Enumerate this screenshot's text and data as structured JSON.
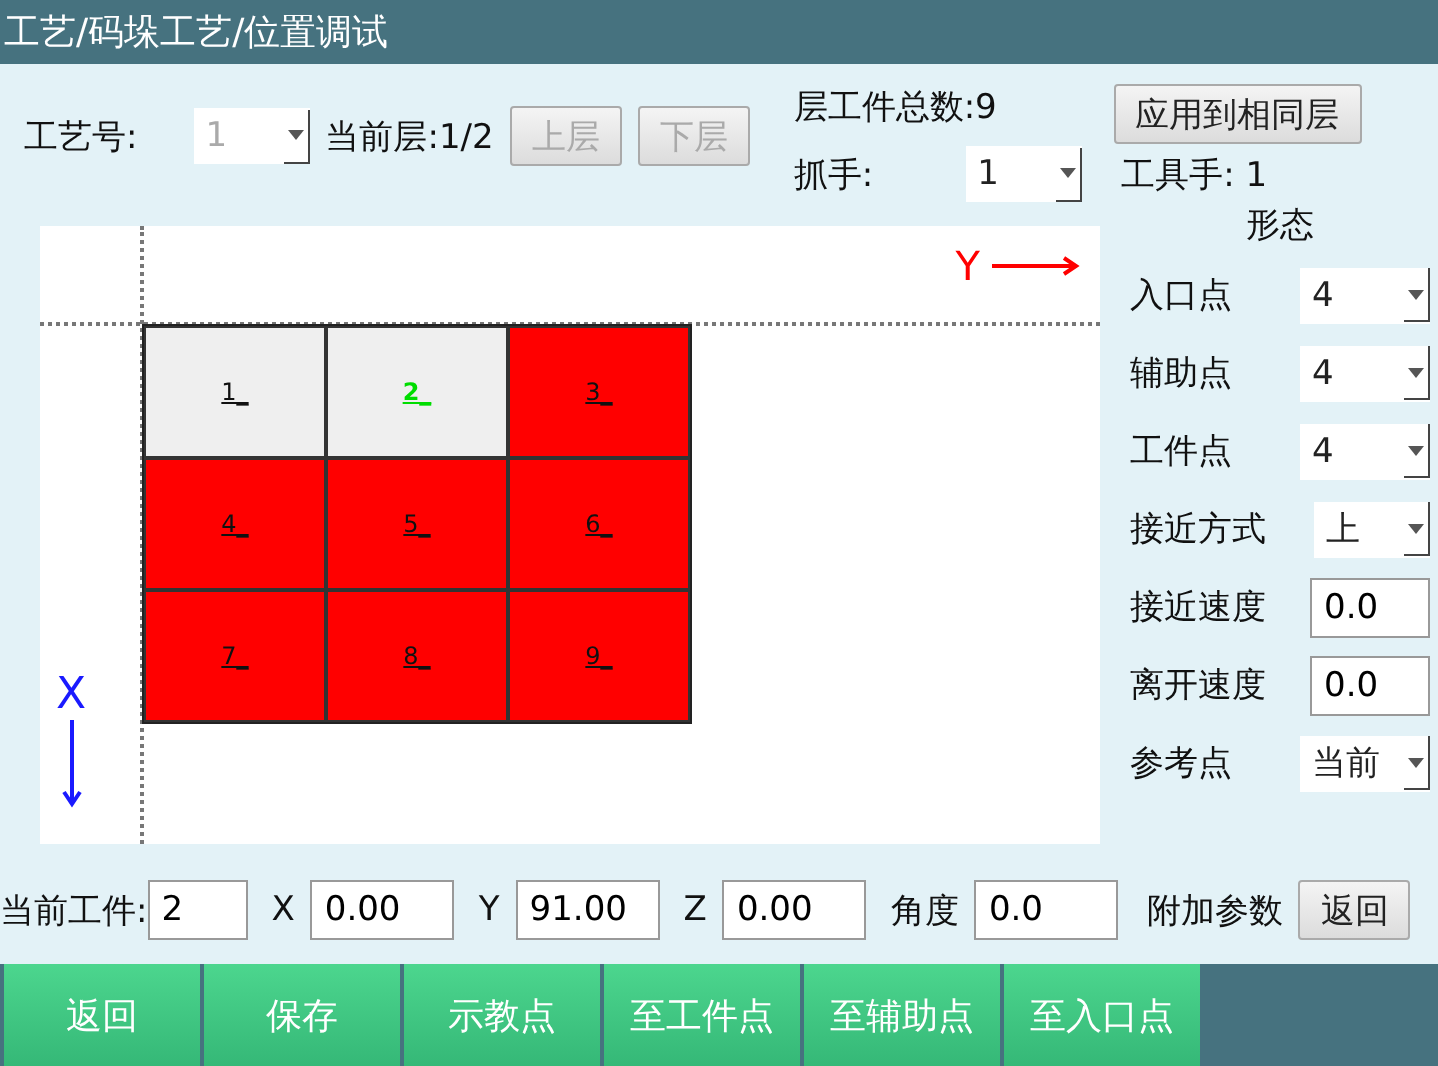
{
  "window": {
    "title": "工艺/码垛工艺/位置调试"
  },
  "header": {
    "craft": {
      "label": "工艺号:",
      "value": "1",
      "disabled": true
    },
    "layer": "当前层:1/2",
    "layer_buttons": [
      {
        "label": "上层",
        "disabled": true
      },
      {
        "label": "下层",
        "disabled": true
      }
    ],
    "total": "层工件总数:9",
    "gripper": {
      "label": "抓手:",
      "value": "1",
      "disabled": false
    },
    "apply_button": "应用到相同层",
    "tool": "工具手: 1"
  },
  "canvas": {
    "y_axis": "Y",
    "x_axis": "X",
    "cells": [
      {
        "label": "1_",
        "filled": false,
        "selected": false
      },
      {
        "label": "2_",
        "filled": false,
        "selected": true
      },
      {
        "label": "3_",
        "filled": true,
        "selected": false
      },
      {
        "label": "4_",
        "filled": true,
        "selected": false
      },
      {
        "label": "5_",
        "filled": true,
        "selected": false
      },
      {
        "label": "6_",
        "filled": true,
        "selected": false
      },
      {
        "label": "7_",
        "filled": true,
        "selected": false
      },
      {
        "label": "8_",
        "filled": true,
        "selected": false
      },
      {
        "label": "9_",
        "filled": true,
        "selected": false
      }
    ]
  },
  "posture": {
    "title": "形态",
    "rows": [
      {
        "kind": "select",
        "label": "入口点",
        "value": "4"
      },
      {
        "kind": "select",
        "label": "辅助点",
        "value": "4"
      },
      {
        "kind": "select",
        "label": "工件点",
        "value": "4"
      },
      {
        "kind": "select",
        "label": "接近方式",
        "value": "上"
      },
      {
        "kind": "input",
        "label": "接近速度",
        "value": "0.0"
      },
      {
        "kind": "input",
        "label": "离开速度",
        "value": "0.0"
      },
      {
        "kind": "select",
        "label": "参考点",
        "value": "当前"
      }
    ]
  },
  "position": {
    "fields": [
      {
        "label": "当前工件:",
        "value": "2"
      },
      {
        "label": "X",
        "value": "0.00"
      },
      {
        "label": "Y",
        "value": "91.00"
      },
      {
        "label": "Z",
        "value": "0.00"
      },
      {
        "label": "角度",
        "value": "0.0"
      }
    ],
    "extra_label": "附加参数",
    "back_button": "返回"
  },
  "actions": [
    "返回",
    "保存",
    "示教点",
    "至工件点",
    "至辅助点",
    "至入口点"
  ]
}
